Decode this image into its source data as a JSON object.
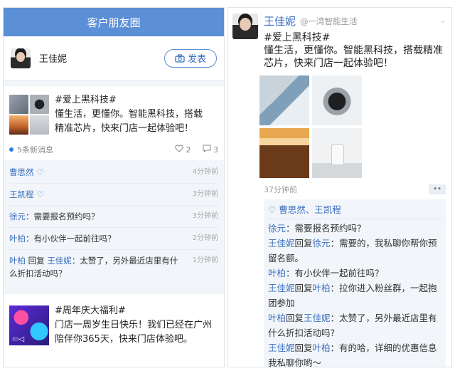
{
  "left": {
    "header_title": "客户朋友圈",
    "user_name": "王佳妮",
    "publish_label": "发表",
    "post1": {
      "text_line1": "#爱上黑科技#",
      "text_line2": "懂生活，更懂你。智能黑科技，搭载",
      "text_line3": "精准芯片，快来门店一起体验吧！",
      "new_messages": "5条新消息",
      "like_count": "2",
      "comment_count": "3",
      "comments": [
        {
          "name": "曹思然",
          "body": "",
          "time": "4分钟前",
          "liked": true
        },
        {
          "name": "王凯程",
          "body": "",
          "time": "3分钟前",
          "liked": true
        },
        {
          "name": "徐元",
          "body": "：需要报名预约吗？",
          "time": "3分钟前",
          "liked": false
        },
        {
          "name": "叶柏",
          "body": "：有小伙伴一起前往吗？",
          "time": "2分钟前",
          "liked": false
        },
        {
          "name": "叶柏",
          "reply_word": " 回复 ",
          "target": "王佳妮",
          "body": "：太赞了，另外最近店里有什么折扣活动吗？",
          "time": "1分钟前",
          "liked": false
        }
      ]
    },
    "post2": {
      "text_line1": "#周年庆大福利#",
      "text_line2": "门店一周岁生日快乐！我们已经在广州",
      "text_line3": "陪伴你365天，快来门店体验吧。"
    }
  },
  "right": {
    "name": "王佳妮",
    "org": "@一湾智能生活",
    "text_line1": "#爱上黑科技#",
    "text_line2": "懂生活，更懂你。智能黑科技，搭载精准芯片，快来门店一起体验吧！",
    "time": "37分钟前",
    "likes": "曹思然、王凯程",
    "comments": [
      {
        "name": "徐元",
        "body": "：需要报名预约吗？"
      },
      {
        "name": "王佳妮",
        "reply_word": "回复",
        "target": "徐元",
        "body": "：需要的，我私聊你帮你预留名额。"
      },
      {
        "name": "叶柏",
        "body": "：有小伙伴一起前往吗？"
      },
      {
        "name": "王佳妮",
        "reply_word": "回复",
        "target": "叶柏",
        "body": "：拉你进入粉丝群，一起抱团参加"
      },
      {
        "name": "叶柏",
        "reply_word": "回复",
        "target": "王佳妮",
        "body": "：太赞了，另外最近店里有什么折扣活动吗？"
      },
      {
        "name": "王佳妮",
        "reply_word": "回复",
        "target": "叶柏",
        "body": "：有的哈，详细的优惠信息我私聊你哟～"
      }
    ]
  },
  "colors": {
    "accent": "#5b8fd6",
    "link": "#3a6fc0",
    "comment_bg": "#f2f5f9"
  },
  "icons": [
    "camera-icon",
    "heart-icon",
    "comment-icon",
    "more-icon"
  ]
}
